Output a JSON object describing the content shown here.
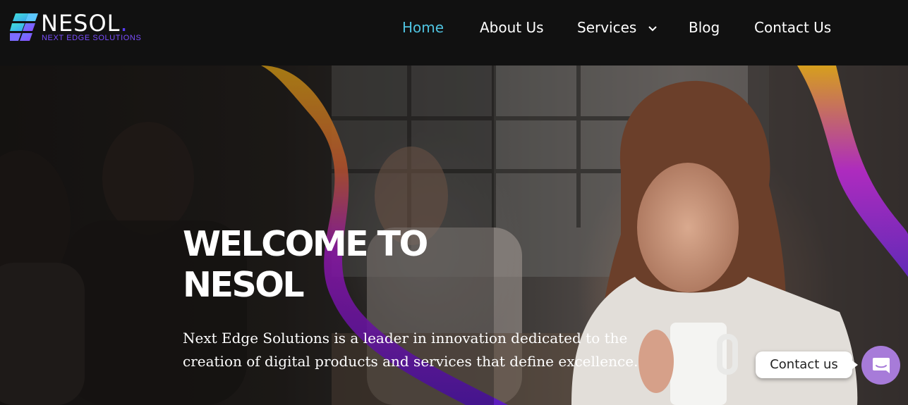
{
  "brand": {
    "name": "NESOL",
    "dot": ".",
    "tagline": "NEXT EDGE SOLUTIONS",
    "icon": "nesol-logo-mark"
  },
  "nav": {
    "items": [
      {
        "label": "Home",
        "active": true
      },
      {
        "label": "About Us"
      },
      {
        "label": "Services",
        "icon": "chevron-down-icon"
      },
      {
        "label": "Blog"
      },
      {
        "label": "Contact Us"
      }
    ]
  },
  "hero": {
    "title_line1": "WELCOME TO",
    "title_line2": "NESOL",
    "description": "Next Edge Solutions is a leader in innovation dedicated to the creation of digital products and services that define excellence."
  },
  "chat": {
    "bubble_label": "Contact us",
    "icon": "chat-icon"
  },
  "colors": {
    "nav_active": "#4fc3e0",
    "chat_button": "#a77bd9",
    "brand_accent": "#7b4dff"
  }
}
